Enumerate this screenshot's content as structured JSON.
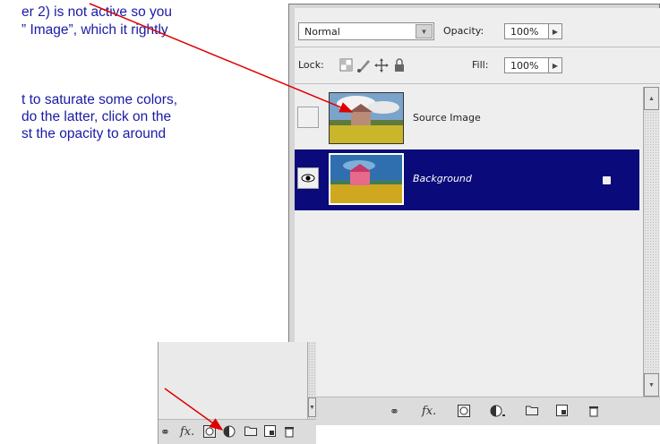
{
  "tutorial": {
    "lines": [
      "er 2) is not active so you",
      "” Image”, which it rightly",
      "t to saturate some colors,",
      "do the latter, click on the",
      "st the opacity to around"
    ],
    "text_color": "#1a1aa6"
  },
  "layers_panel": {
    "blend_mode": "Normal",
    "opacity_label": "Opacity:",
    "opacity_value": "100%",
    "lock_label": "Lock:",
    "fill_label": "Fill:",
    "fill_value": "100%",
    "layers": [
      {
        "name": "Source Image",
        "visible": false,
        "selected": false
      },
      {
        "name": "Background",
        "visible": true,
        "selected": true,
        "locked": true
      }
    ],
    "selection_color": "#0a0a7a"
  },
  "footer_icons": [
    "link-icon",
    "fx-icon",
    "layer-mask-icon",
    "adjustment-layer-icon",
    "group-folder-icon",
    "new-layer-icon",
    "trash-icon"
  ],
  "annotation_color": "#e00000"
}
